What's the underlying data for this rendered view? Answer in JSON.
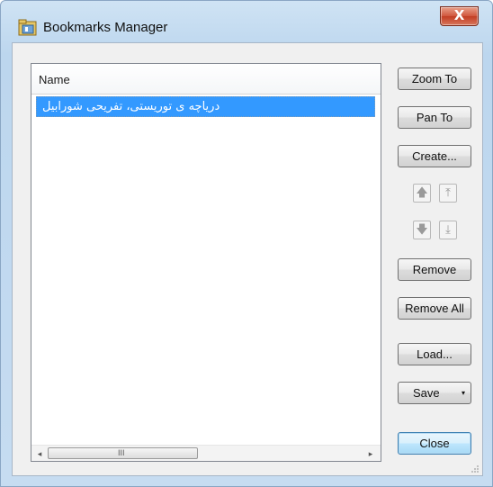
{
  "window": {
    "title": "Bookmarks Manager",
    "close_glyph": "X"
  },
  "list": {
    "header": "Name",
    "rows": [
      {
        "label": "دریاچه ی توریستی، تفریحی شورابیل",
        "selected": true
      }
    ],
    "scroll": {
      "left_arrow": "◂",
      "right_arrow": "▸",
      "grip": "III"
    }
  },
  "buttons": {
    "zoom_to": "Zoom To",
    "pan_to": "Pan To",
    "create": "Create...",
    "remove": "Remove",
    "remove_all": "Remove All",
    "load": "Load...",
    "save": "Save",
    "save_arrow": "▾",
    "close": "Close"
  },
  "reorder": {
    "move_up": "🡅",
    "move_top": "⤒",
    "move_down": "🡇",
    "move_bottom": "⤓"
  },
  "colors": {
    "selection": "#3399ff",
    "close_button": "#c94a2f"
  },
  "icons": {
    "app": "bookmarks-folder-icon"
  }
}
